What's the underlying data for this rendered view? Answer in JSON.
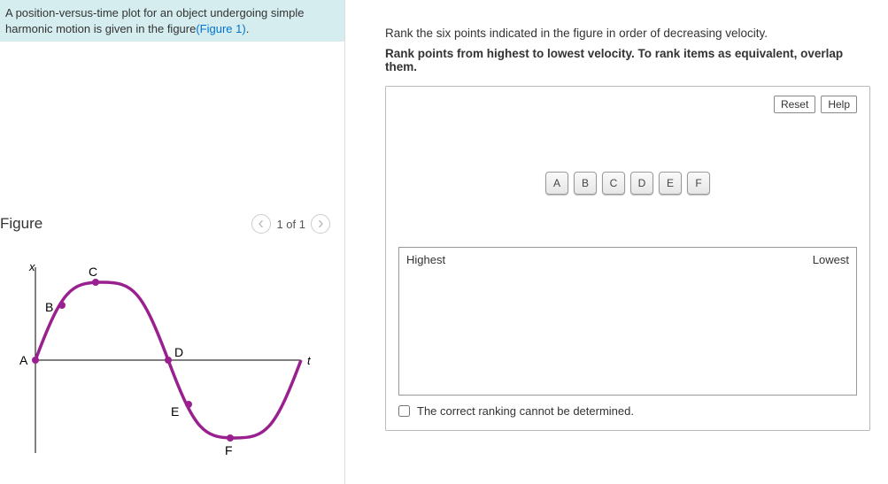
{
  "problem": {
    "text_before_link": "A position-versus-time plot for an object undergoing simple harmonic motion is given in the figure",
    "link_text": "(Figure 1)",
    "text_after_link": "."
  },
  "figure": {
    "title": "Figure",
    "page_indicator": "1 of 1",
    "x_axis_label": "t",
    "y_axis_label": "x",
    "point_labels": [
      "A",
      "B",
      "C",
      "D",
      "E",
      "F"
    ]
  },
  "instructions": {
    "line1": "Rank the six points indicated in the figure in order of decreasing velocity.",
    "line2": "Rank points from highest to lowest velocity. To rank items as equivalent, overlap them."
  },
  "widget": {
    "reset_label": "Reset",
    "help_label": "Help",
    "tiles": [
      "A",
      "B",
      "C",
      "D",
      "E",
      "F"
    ],
    "target_left": "Highest",
    "target_right": "Lowest",
    "cannot_determine_label": "The correct ranking cannot be determined."
  }
}
